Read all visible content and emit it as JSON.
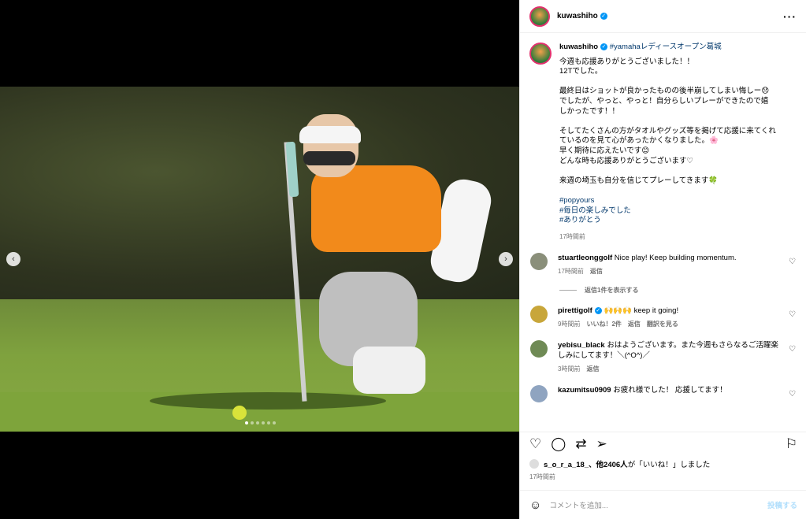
{
  "post": {
    "username": "kuwashiho",
    "location_tag": "#yamahaレディースオープン葛城",
    "caption_lines": [
      "今週も応援ありがとうございました！！",
      "12Tでした。"
    ],
    "caption_para2": [
      "最終日はショットが良かったものの後半崩してしまい悔しー😞",
      "でしたが、やっと、やっと！自分らしいプレーができたので嬉",
      "しかったです！！"
    ],
    "caption_para3": [
      "そしてたくさんの方がタオルやグッズ等を掲げて応援に来てくれ",
      "ているのを見て心があったかくなりました。🌸",
      "早く期待に応えたいです😊",
      "どんな時も応援ありがとうございます♡"
    ],
    "caption_para4": "来週の埼玉も自分を信じてプレーしてきます🍀",
    "hashtags": [
      "#popyours",
      "#毎日の楽しみでした",
      "#ありがとう"
    ],
    "caption_time": "17時間前",
    "likes_user": "s_o_r_a_18_、他2406人",
    "likes_suffix": "が「いいね！」しました",
    "post_time": "17時間前"
  },
  "comments": [
    {
      "user": "stuartleonggolf",
      "text": "Nice play! Keep building momentum.",
      "time": "17時間前",
      "actions": [
        "返信"
      ],
      "avatar_color": "#8a8f7a"
    },
    {
      "user": "pirettigolf",
      "text": "🙌🙌🙌 keep it going!",
      "time": "9時間前",
      "actions": [
        "いいね！2件",
        "返信",
        "翻訳を見る"
      ],
      "avatar_color": "#c8a63a",
      "verified": true
    },
    {
      "user": "yebisu_black",
      "text": "おはようございます。また今週もさらなるご活躍楽しみにしてます！＼(^O^)／",
      "time": "3時間前",
      "actions": [
        "返信"
      ],
      "avatar_color": "#6f8a55"
    },
    {
      "user": "kazumitsu0909",
      "text": "お疲れ様でした！ 応援してます！",
      "time": "",
      "actions": [],
      "avatar_color": "#8fa4c0"
    }
  ],
  "replies_toggle": "返信1件を表示する",
  "comment_input": {
    "placeholder": "コメントを追加...",
    "post_label": "投稿する"
  },
  "icons": [
    "more-icon",
    "heart-icon",
    "comment-icon",
    "share-icon",
    "send-icon",
    "bookmark-icon",
    "emoji-icon",
    "chevron-left-icon",
    "chevron-right-icon"
  ],
  "carousel": {
    "slide_count": 6,
    "active_index": 0
  }
}
